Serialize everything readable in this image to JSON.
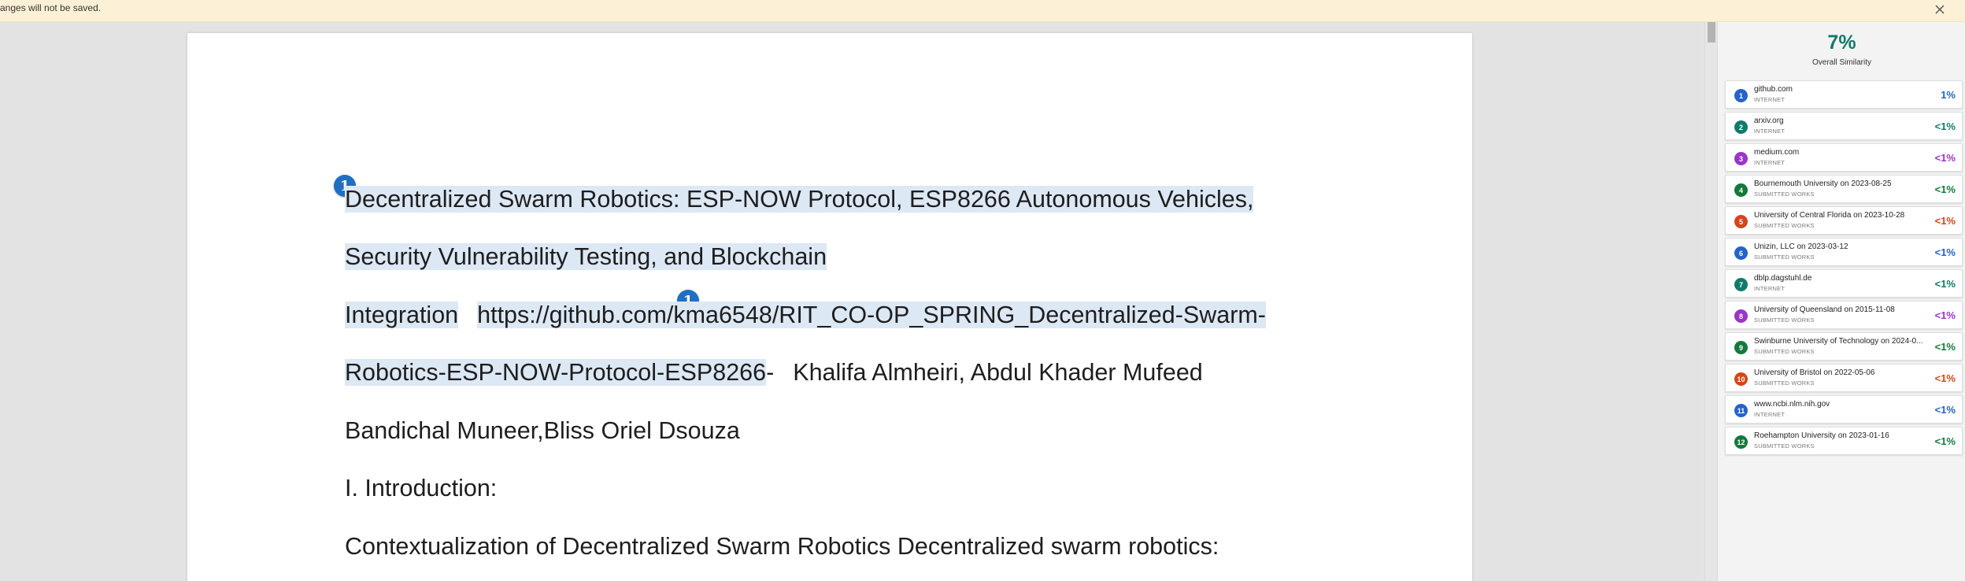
{
  "banner": {
    "text": "anges will not be saved.",
    "close_icon": "close-icon"
  },
  "document": {
    "markers": [
      "1",
      "1"
    ],
    "lines": {
      "title_1": "Decentralized Swarm Robotics: ESP-NOW Protocol, ESP8266 Autonomous Vehicles,",
      "title_2": "Security Vulnerability Testing, and Blockchain",
      "title_3": "Integration",
      "url_1": "https://github.com/kma6548/RIT_CO-OP_SPRING_Decentralized-Swarm-",
      "url_2": "Robotics-ESP-NOW-Protocol-ESP8266",
      "url_dash": "-",
      "authors_1": "Khalifa Almheiri, Abdul Khader Mufeed",
      "authors_2": "Bandichal Muneer,Bliss Oriel Dsouza",
      "heading": "I. Introduction:",
      "body_1": "Contextualization of Decentralized Swarm Robotics Decentralized swarm robotics:"
    }
  },
  "similarity": {
    "overall_percent": "7%",
    "overall_label": "Overall Similarity",
    "sources": [
      {
        "num": "1",
        "name": "github.com",
        "type": "INTERNET",
        "pct": "1%",
        "color": "#2563c9"
      },
      {
        "num": "2",
        "name": "arxiv.org",
        "type": "INTERNET",
        "pct": "<1%",
        "color": "#117a6a"
      },
      {
        "num": "3",
        "name": "medium.com",
        "type": "INTERNET",
        "pct": "<1%",
        "color": "#9a35c8"
      },
      {
        "num": "4",
        "name": "Bournemouth University on 2023-08-25",
        "type": "SUBMITTED WORKS",
        "pct": "<1%",
        "color": "#137a3c"
      },
      {
        "num": "5",
        "name": "University of Central Florida on 2023-10-28",
        "type": "SUBMITTED WORKS",
        "pct": "<1%",
        "color": "#d2461a"
      },
      {
        "num": "6",
        "name": "Unizin, LLC on 2023-03-12",
        "type": "SUBMITTED WORKS",
        "pct": "<1%",
        "color": "#2563c9"
      },
      {
        "num": "7",
        "name": "dblp.dagstuhl.de",
        "type": "INTERNET",
        "pct": "<1%",
        "color": "#117a6a"
      },
      {
        "num": "8",
        "name": "University of Queensland on 2015-11-08",
        "type": "SUBMITTED WORKS",
        "pct": "<1%",
        "color": "#9a35c8"
      },
      {
        "num": "9",
        "name": "Swinburne University of Technology on 2024-0...",
        "type": "SUBMITTED WORKS",
        "pct": "<1%",
        "color": "#137a3c"
      },
      {
        "num": "10",
        "name": "University of Bristol on 2022-05-06",
        "type": "SUBMITTED WORKS",
        "pct": "<1%",
        "color": "#d2461a"
      },
      {
        "num": "11",
        "name": "www.ncbi.nlm.nih.gov",
        "type": "INTERNET",
        "pct": "<1%",
        "color": "#2563c9"
      },
      {
        "num": "12",
        "name": "Roehampton University on 2023-01-16",
        "type": "SUBMITTED WORKS",
        "pct": "<1%",
        "color": "#137a3c"
      }
    ]
  }
}
